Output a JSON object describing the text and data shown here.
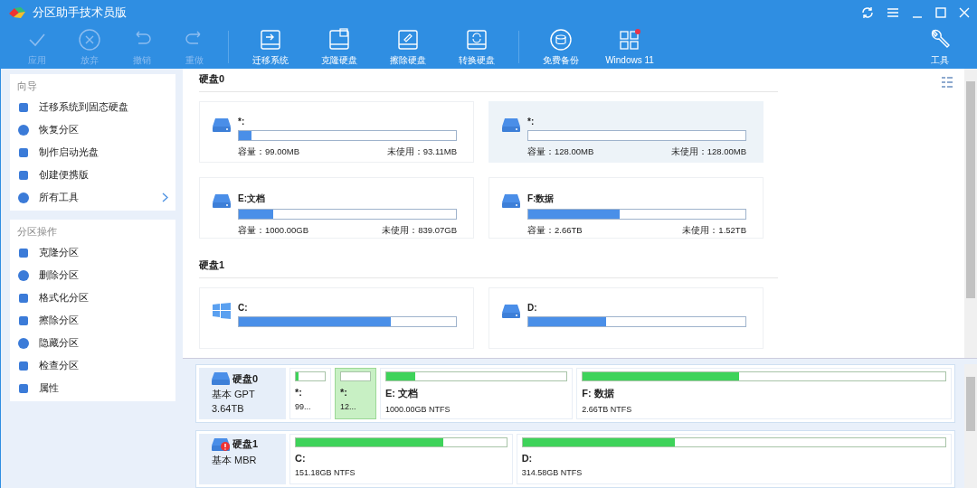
{
  "window": {
    "title": "分区助手技术员版"
  },
  "toolbar": [
    {
      "label": "应用",
      "disabled": true,
      "badge": false
    },
    {
      "label": "放弃",
      "disabled": true,
      "badge": false
    },
    {
      "label": "撤销",
      "disabled": true,
      "badge": false
    },
    {
      "label": "重做",
      "disabled": true,
      "badge": false
    },
    {
      "label": "迁移系统",
      "disabled": false,
      "badge": false
    },
    {
      "label": "克隆硬盘",
      "disabled": false,
      "badge": false
    },
    {
      "label": "擦除硬盘",
      "disabled": false,
      "badge": false
    },
    {
      "label": "转换硬盘",
      "disabled": false,
      "badge": false
    },
    {
      "label": "免费备份",
      "disabled": false,
      "badge": false
    },
    {
      "label": "Windows 11",
      "disabled": false,
      "badge": true
    }
  ],
  "tools_button": {
    "label": "工具"
  },
  "sidebar": [
    {
      "title": "向导",
      "items": [
        {
          "label": "迁移系统到固态硬盘",
          "submenu": false
        },
        {
          "label": "恢复分区",
          "submenu": false
        },
        {
          "label": "制作启动光盘",
          "submenu": false
        },
        {
          "label": "创建便携版",
          "submenu": false
        },
        {
          "label": "所有工具",
          "submenu": true
        }
      ]
    },
    {
      "title": "分区操作",
      "items": [
        {
          "label": "克隆分区",
          "submenu": false
        },
        {
          "label": "删除分区",
          "submenu": false
        },
        {
          "label": "格式化分区",
          "submenu": false
        },
        {
          "label": "擦除分区",
          "submenu": false
        },
        {
          "label": "隐藏分区",
          "submenu": false
        },
        {
          "label": "检查分区",
          "submenu": false
        },
        {
          "label": "属性",
          "submenu": false
        }
      ]
    }
  ],
  "disks": [
    {
      "name": "硬盘0",
      "partitions": [
        {
          "name": "*:",
          "kind": "data",
          "level": 0.06,
          "selected": false,
          "capacity": "容量：99.00MB",
          "free": "未使用：93.11MB"
        },
        {
          "name": "*:",
          "kind": "data",
          "selected": true,
          "capacity": "容量：128.00MB",
          "free": "未使用：128.00MB"
        },
        {
          "name": "E:文档",
          "kind": "data",
          "level": 0.16,
          "selected": false,
          "capacity": "容量：1000.00GB",
          "free": "未使用：839.07GB"
        },
        {
          "name": "F:数据",
          "kind": "data",
          "level": 0.42,
          "selected": false,
          "capacity": "容量：2.66TB",
          "free": "未使用：1.52TB"
        }
      ]
    },
    {
      "name": "硬盘1",
      "partitions": [
        {
          "name": "C:",
          "kind": "system",
          "level": 0.7,
          "selected": false
        },
        {
          "name": "D:",
          "kind": "data",
          "level": 0.36,
          "selected": false
        }
      ]
    }
  ],
  "disk_map": [
    {
      "name": "硬盘0",
      "type": "基本 GPT",
      "size": "3.64TB",
      "warning": false,
      "partitions": [
        {
          "label": "*:",
          "info": "99...",
          "kind": "small",
          "level": 0.1,
          "selected": false
        },
        {
          "label": "*:",
          "info": "12...",
          "kind": "small",
          "selected": true
        },
        {
          "label": "E: 文档",
          "info": "1000.00GB NTFS",
          "kind": "medium",
          "level": 0.16,
          "selected": false
        },
        {
          "label": "F: 数据",
          "info": "2.66TB NTFS",
          "kind": "large",
          "level": 0.43,
          "selected": false
        }
      ]
    },
    {
      "name": "硬盘1",
      "type": "基本 MBR",
      "warning": true,
      "partitions": [
        {
          "label": "C:",
          "info": "151.18GB NTFS",
          "kind": "medium",
          "level": 0.7,
          "selected": false
        },
        {
          "label": "D:",
          "info": "314.58GB NTFS",
          "kind": "large",
          "level": 0.36,
          "selected": false
        }
      ]
    }
  ]
}
